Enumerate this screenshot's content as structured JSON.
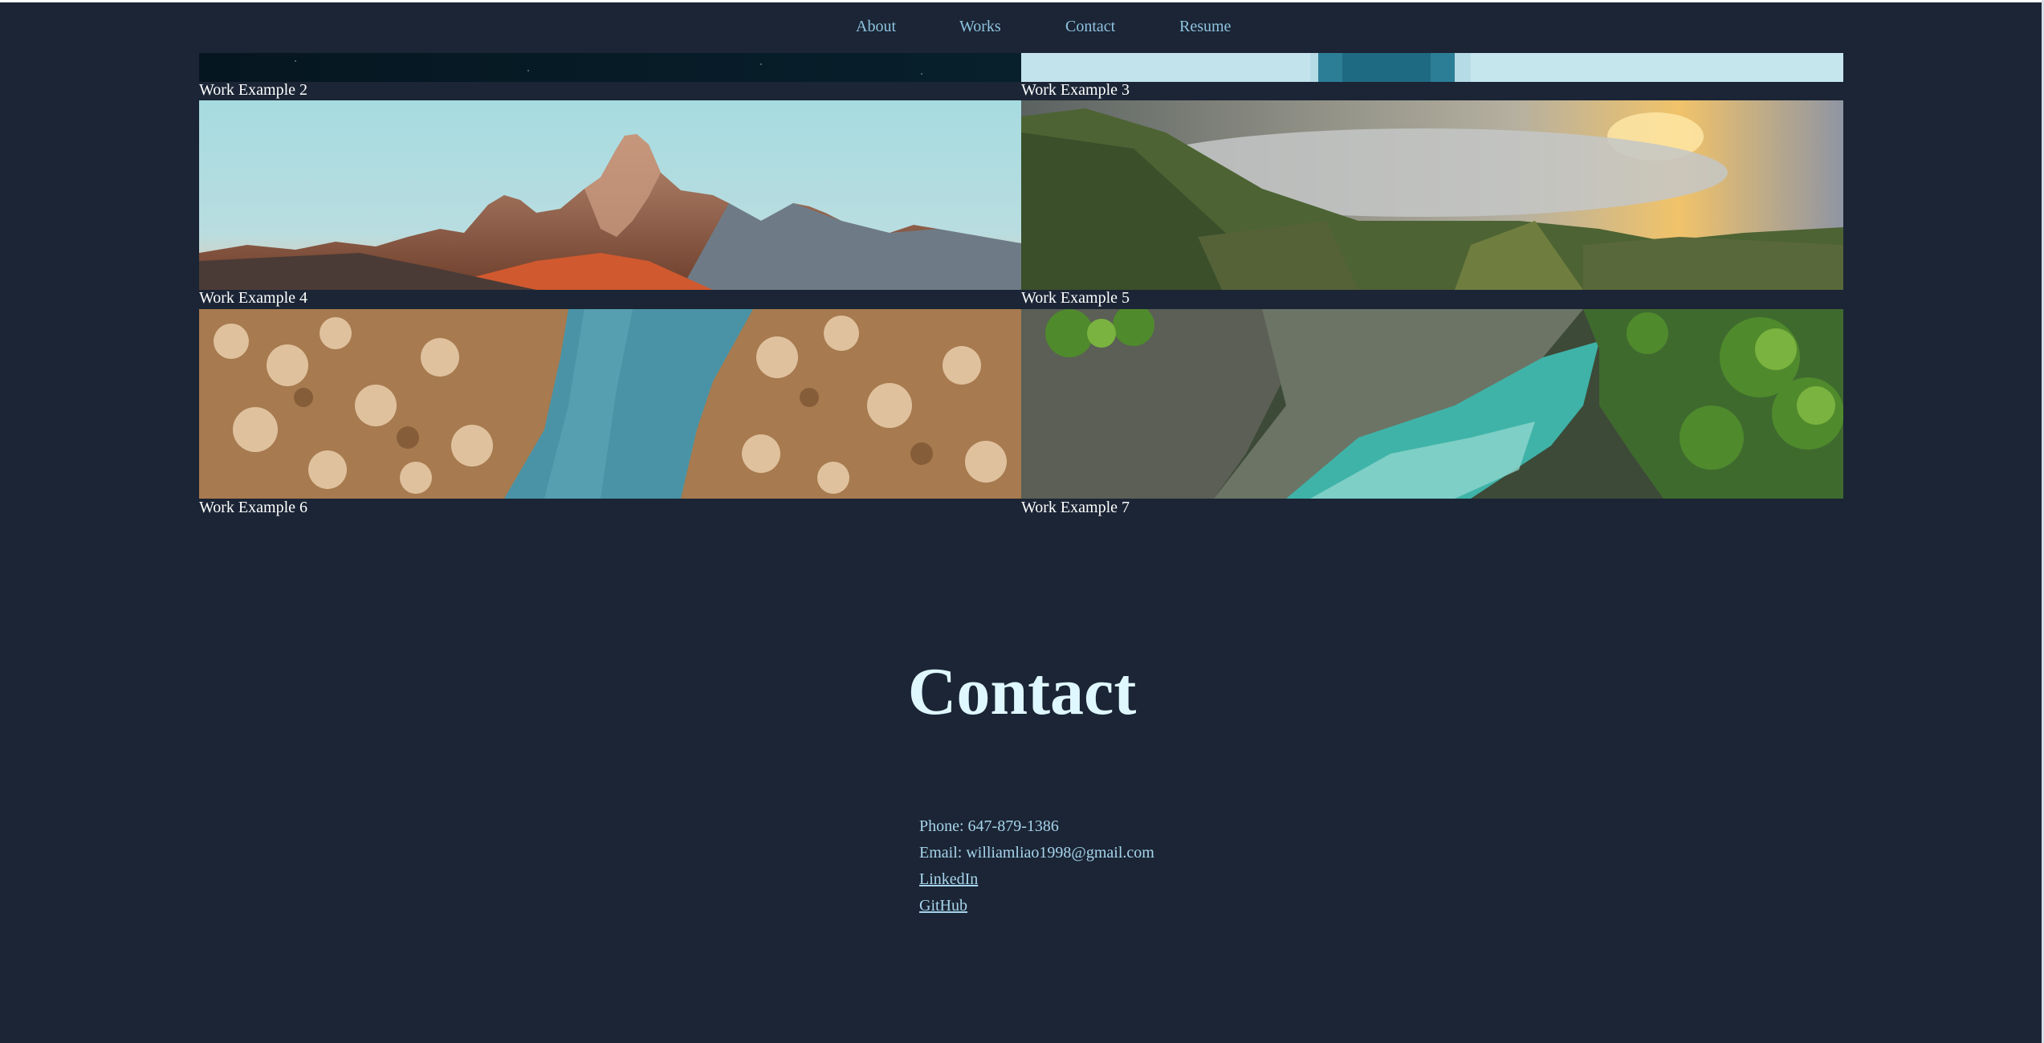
{
  "nav": {
    "items": [
      {
        "label": "About"
      },
      {
        "label": "Works"
      },
      {
        "label": "Contact"
      },
      {
        "label": "Resume"
      }
    ]
  },
  "works": [
    {
      "caption": "Work Example 2",
      "image": "night-sky-photo"
    },
    {
      "caption": "Work Example 3",
      "image": "waterfall-photo"
    },
    {
      "caption": "Work Example 4",
      "image": "mountain-peaks-photo"
    },
    {
      "caption": "Work Example 5",
      "image": "misty-valley-photo"
    },
    {
      "caption": "Work Example 6",
      "image": "aerial-forest-river-photo"
    },
    {
      "caption": "Work Example 7",
      "image": "turquoise-river-canyon-photo"
    }
  ],
  "contact": {
    "title": "Contact",
    "phone": "Phone: 647-879-1386",
    "email": "Email: williamliao1998@gmail.com",
    "linkedin": "LinkedIn",
    "github": "GitHub"
  },
  "colors": {
    "background": "#1b2535",
    "nav_link": "#8ec3e0",
    "title": "#dff7ff",
    "contact_text": "#a7d5ec"
  }
}
